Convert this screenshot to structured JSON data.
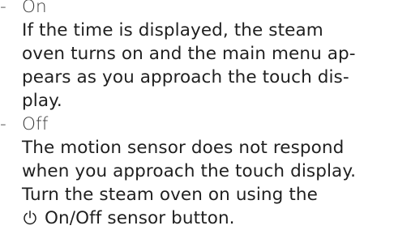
{
  "options": [
    {
      "dash": "-",
      "label": "On",
      "lines": [
        "If the time is displayed, the steam",
        "oven turns on and the main menu ap-",
        "pears as you approach the touch dis-",
        "play."
      ]
    },
    {
      "dash": "-",
      "label": "Off",
      "lines": [
        "The motion sensor does not respond",
        "when you approach the touch display.",
        "Turn the steam oven on using the"
      ],
      "button_line": {
        "icon": "power-icon",
        "text": "On/Off sensor button."
      }
    }
  ]
}
